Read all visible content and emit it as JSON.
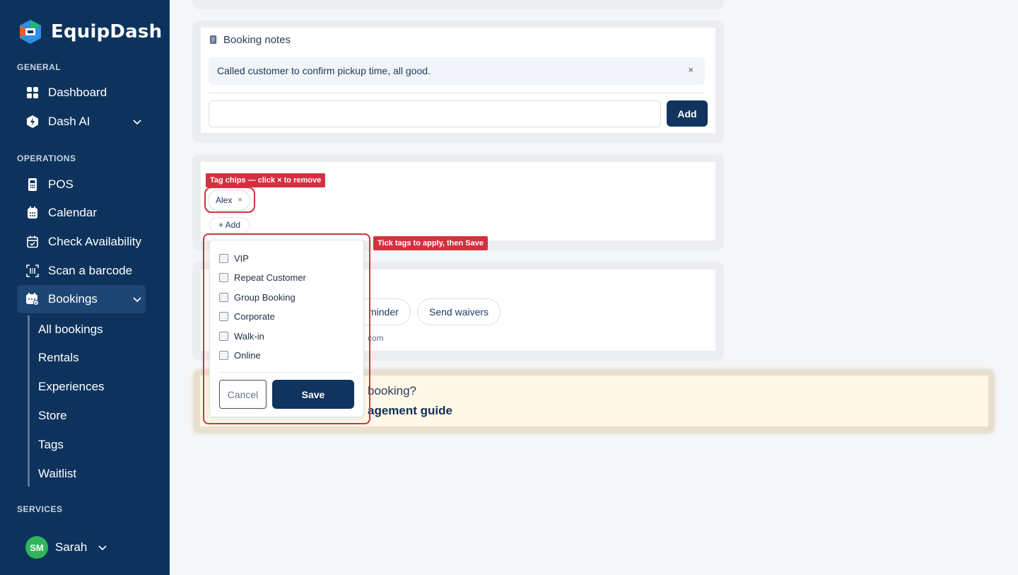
{
  "brand": {
    "name": "EquipDash"
  },
  "sidebar": {
    "sections": {
      "general": "GENERAL",
      "operations": "OPERATIONS",
      "services": "SERVICES"
    },
    "items": {
      "dashboard": "Dashboard",
      "dash_ai": "Dash AI",
      "pos": "POS",
      "calendar": "Calendar",
      "check_availability": "Check Availability",
      "scan_barcode": "Scan a barcode",
      "bookings": "Bookings"
    },
    "bookings_sub": [
      "All bookings",
      "Rentals",
      "Experiences",
      "Store",
      "Tags",
      "Waitlist"
    ],
    "user": {
      "initials": "SM",
      "name": "Sarah"
    }
  },
  "notes": {
    "title": "Booking notes",
    "existing_note": "Called customer to confirm pickup time, all good.",
    "remove_glyph": "×",
    "input_value": "",
    "add_label": "Add"
  },
  "tags": {
    "chips": [
      {
        "label": "Alex",
        "remove_glyph": "×"
      }
    ],
    "add_label": "+ Add",
    "options": [
      "VIP",
      "Repeat Customer",
      "Group Booking",
      "Corporate",
      "Walk-in",
      "Online"
    ],
    "cancel_label": "Cancel",
    "save_label": "Save"
  },
  "actions": {
    "reminder_fragment": "minder",
    "send_waivers": "Send waivers",
    "email_fragment": "com"
  },
  "help": {
    "question_fragment": "booking?",
    "link_fragment": "agement guide"
  },
  "callouts": {
    "chips": "Tag chips — click × to remove",
    "dropdown": "Tick tags to apply, then Save"
  },
  "colors": {
    "sidebar": "#0d335d",
    "primary": "#10345e",
    "accent_red": "#d4303f",
    "avatar": "#2fb65b"
  }
}
